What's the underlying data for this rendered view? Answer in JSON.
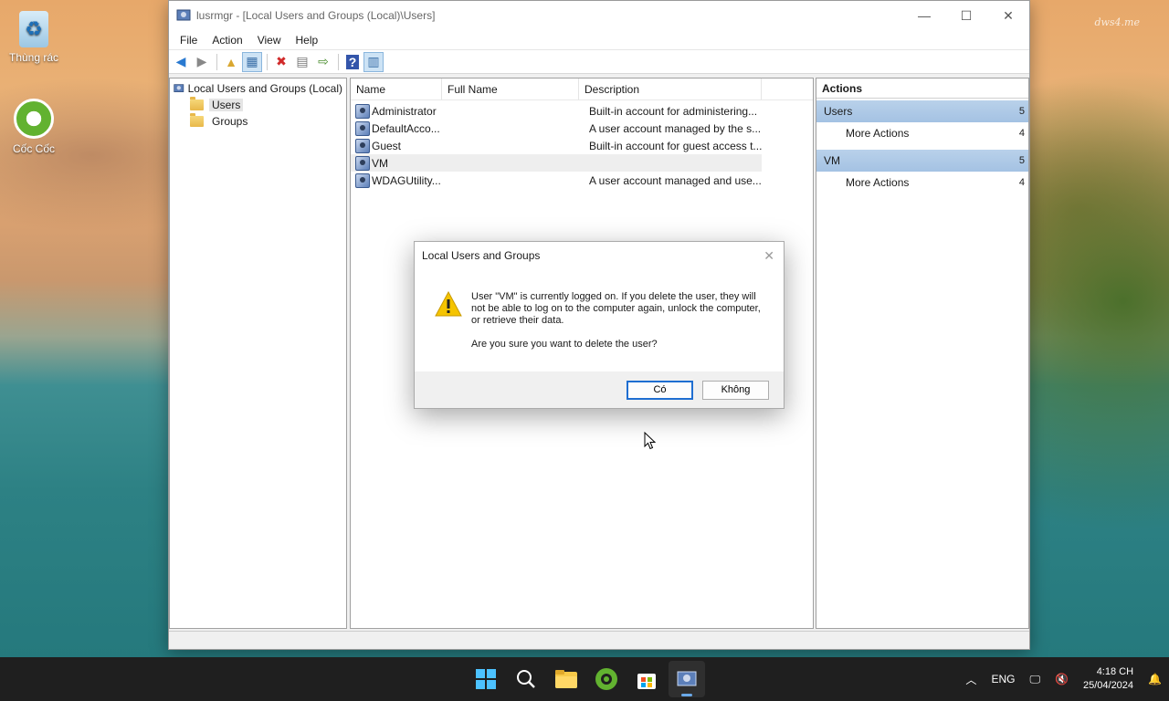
{
  "desktop": {
    "icons": [
      {
        "label": "Thùng rác"
      },
      {
        "label": "Cốc Cốc"
      }
    ],
    "watermark": "dws4.me"
  },
  "window": {
    "title": "lusrmgr - [Local Users and Groups (Local)\\Users]",
    "menu": [
      "File",
      "Action",
      "View",
      "Help"
    ]
  },
  "tree": {
    "root": "Local Users and Groups (Local)",
    "items": [
      "Users",
      "Groups"
    ]
  },
  "list": {
    "columns": [
      "Name",
      "Full Name",
      "Description"
    ],
    "rows": [
      {
        "name": "Administrator",
        "full_name": "",
        "description": "Built-in account for administering..."
      },
      {
        "name": "DefaultAcco...",
        "full_name": "",
        "description": "A user account managed by the s..."
      },
      {
        "name": "Guest",
        "full_name": "",
        "description": "Built-in account for guest access t..."
      },
      {
        "name": "VM",
        "full_name": "",
        "description": ""
      },
      {
        "name": "WDAGUtility...",
        "full_name": "",
        "description": "A user account managed and use..."
      }
    ]
  },
  "actions": {
    "header": "Actions",
    "sections": [
      {
        "title": "Users",
        "more": "More Actions"
      },
      {
        "title": "VM",
        "more": "More Actions"
      }
    ]
  },
  "dialog": {
    "title": "Local Users and Groups",
    "message": "User \"VM\" is currently logged on. If you delete the user, they will not be able to log on to the computer again, unlock the computer, or retrieve their data.",
    "question": "Are you sure you want to delete the user?",
    "yes_label": "Có",
    "no_label": "Không"
  },
  "taskbar": {
    "language": "ENG",
    "time": "4:18 CH",
    "date": "25/04/2024"
  }
}
